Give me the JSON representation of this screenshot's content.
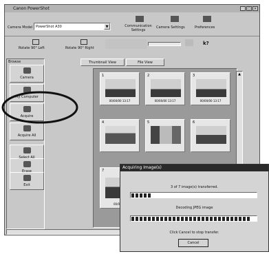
{
  "window": {
    "title": "Canon PowerShot",
    "controls": [
      "_",
      "□",
      "×"
    ]
  },
  "toolbar": {
    "camera_model_label": "Camera Model",
    "camera_model_value": "PowerShot A30",
    "communication_settings": "Communication Settings",
    "camera_settings": "Camera Settings",
    "preferences": "Preferences"
  },
  "toolbar2": {
    "rotate_left": "Rotate 90° Left",
    "rotate_right": "Rotate 90° Right",
    "help": "k?"
  },
  "sidebar": {
    "header": "Browse",
    "items": [
      {
        "label": "Camera",
        "icon": "camera-icon"
      },
      {
        "label": "My Computer",
        "icon": "computer-icon"
      },
      {
        "label": "Acquire",
        "icon": "acquire-icon"
      },
      {
        "label": "Acquire All",
        "icon": "acquire-all-icon"
      },
      {
        "label": "Select All",
        "icon": "select-all-icon"
      },
      {
        "label": "Erase",
        "icon": "erase-icon"
      },
      {
        "label": "Exit",
        "icon": "exit-icon"
      }
    ]
  },
  "tabs": [
    {
      "label": "Thumbnail View"
    },
    {
      "label": "File View"
    }
  ],
  "thumbnails": [
    {
      "num": "1",
      "date": "00/00/00 13:17"
    },
    {
      "num": "2",
      "date": "00/00/00 13:17"
    },
    {
      "num": "3",
      "date": "00/00/00 13:17"
    },
    {
      "num": "4",
      "date": ""
    },
    {
      "num": "5",
      "date": ""
    },
    {
      "num": "6",
      "date": ""
    },
    {
      "num": "7",
      "date": "00/00/00"
    }
  ],
  "dialog": {
    "title": "Acquiring Image(s)",
    "status1": "3 of 7 image(s) transferred.",
    "progress1": 0.15,
    "status2": "Decoding JPEG image",
    "progress2": 0.95,
    "hint": "Click Cancel to stop transfer.",
    "cancel": "Cancel"
  },
  "colors": {
    "window": "#c8c8c8",
    "titlebar": "#b4b4b4",
    "dialog_title": "#2a2a2a",
    "panel": "#9a9a9a"
  }
}
